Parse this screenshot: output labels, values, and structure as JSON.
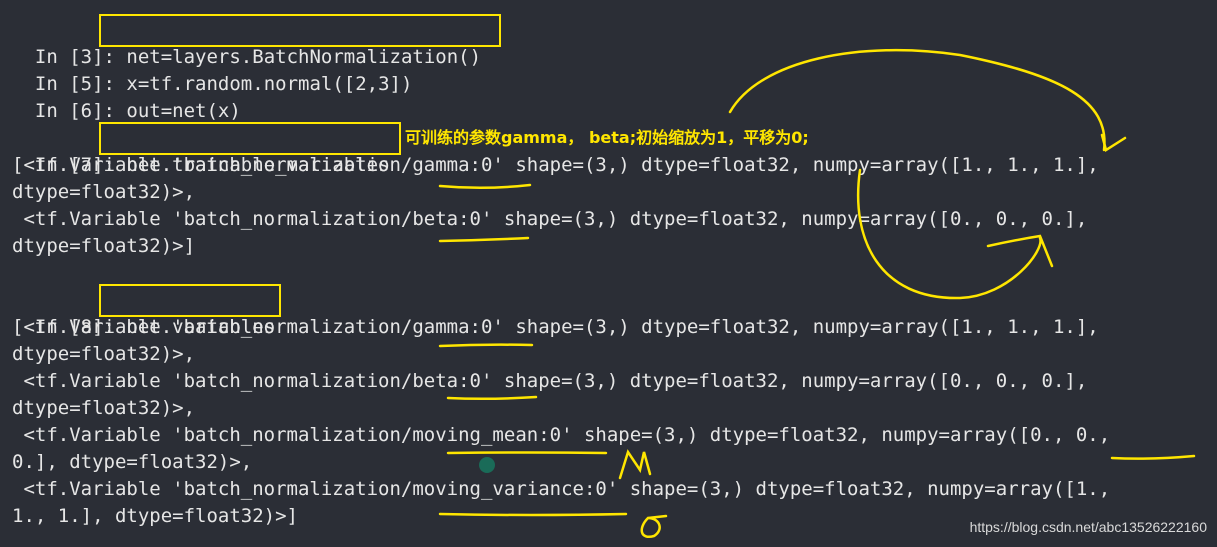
{
  "cells": {
    "c3": {
      "prompt": "In [3]:",
      "code": "net=layers.BatchNormalization()"
    },
    "c5": {
      "prompt": "In [5]:",
      "code": "x=tf.random.normal([2,3])"
    },
    "c6": {
      "prompt": "In [6]:",
      "code": "out=net(x)"
    },
    "c7": {
      "prompt": "In [7]:",
      "code": "net.trainable_variables"
    },
    "c8": {
      "prompt": "In [8]:",
      "code": "net.variables"
    }
  },
  "out7": [
    "[<tf.Variable 'batch_normalization/gamma:0' shape=(3,) dtype=float32, numpy=array([1., 1., 1.],",
    "dtype=float32)>,",
    " <tf.Variable 'batch_normalization/beta:0' shape=(3,) dtype=float32, numpy=array([0., 0., 0.],",
    "dtype=float32)>]"
  ],
  "out8": [
    "[<tf.Variable 'batch_normalization/gamma:0' shape=(3,) dtype=float32, numpy=array([1., 1., 1.],",
    "dtype=float32)>,",
    " <tf.Variable 'batch_normalization/beta:0' shape=(3,) dtype=float32, numpy=array([0., 0., 0.],",
    "dtype=float32)>,",
    " <tf.Variable 'batch_normalization/moving_mean:0' shape=(3,) dtype=float32, numpy=array([0., 0.,",
    "0.], dtype=float32)>,",
    " <tf.Variable 'batch_normalization/moving_variance:0' shape=(3,) dtype=float32, numpy=array([1.,",
    "1., 1.], dtype=float32)>]"
  ],
  "annotation": "可训练的参数gamma， beta;初始缩放为1，平移为0;",
  "handwriting": {
    "mu": "μ",
    "sigma": "σ"
  },
  "watermark": "https://blog.csdn.net/abc13526222160",
  "colors": {
    "background": "#2b2e36",
    "highlight": "#ffe600",
    "number": "#b28bd6",
    "attribute": "#5fa8d3",
    "string": "#e6d98a"
  }
}
